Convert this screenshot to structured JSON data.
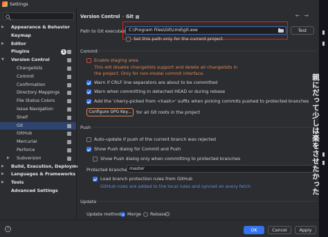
{
  "window": {
    "title": "Settings"
  },
  "sidebar": {
    "items": [
      {
        "label": "Appearance & Behavior",
        "bold": true,
        "chevron": "right",
        "indent": 0
      },
      {
        "label": "Keymap",
        "bold": true,
        "indent": 0
      },
      {
        "label": "Editor",
        "bold": true,
        "chevron": "right",
        "indent": 0
      },
      {
        "label": "Plugins",
        "bold": true,
        "indent": 0,
        "badge": "1"
      },
      {
        "label": "Version Control",
        "bold": true,
        "chevron": "down",
        "indent": 0
      },
      {
        "label": "Changelists",
        "indent": 1
      },
      {
        "label": "Commit",
        "indent": 1
      },
      {
        "label": "Confirmation",
        "indent": 1
      },
      {
        "label": "Directory Mappings",
        "indent": 1
      },
      {
        "label": "File Status Colors",
        "indent": 1
      },
      {
        "label": "Issue Navigation",
        "indent": 1
      },
      {
        "label": "Shelf",
        "indent": 1
      },
      {
        "label": "Git",
        "indent": 1,
        "selected": true
      },
      {
        "label": "GitHub",
        "indent": 1
      },
      {
        "label": "Mercurial",
        "indent": 1
      },
      {
        "label": "Perforce",
        "indent": 1
      },
      {
        "label": "Subversion",
        "indent": 1,
        "chevron": "right"
      },
      {
        "label": "Build, Execution, Deployment",
        "bold": true,
        "chevron": "right",
        "indent": 0
      },
      {
        "label": "Languages & Frameworks",
        "bold": true,
        "chevron": "right",
        "indent": 0
      },
      {
        "label": "Tools",
        "bold": true,
        "chevron": "right",
        "indent": 0
      },
      {
        "label": "Advanced Settings",
        "bold": true,
        "indent": 0
      }
    ]
  },
  "breadcrumb": {
    "parent": "Version Control",
    "separator": "›",
    "current": "Git"
  },
  "git": {
    "path_label": "Path to Git executable:",
    "path_value": "C:\\Program Files\\Git\\cmd\\git.exe",
    "test_button": "Test",
    "path_for_project": "Set this path only for the current project"
  },
  "commit": {
    "heading": "Commit",
    "staging_label": "Enable staging area",
    "staging_note_1": "This will disable changelists support and delete all changelists in",
    "staging_note_2": "the project. Only for non-modal commit interface.",
    "warn_crlf": "Warn if CRLF line separators are about to be committed",
    "warn_detached": "Warn when committing in detached HEAD or during rebase",
    "cherry_pick": "Add the 'cherry-picked from <hash>' suffix when picking commits pushed to protected branches",
    "gpg_button": "Configure GPG Key...",
    "gpg_note": "for all Git roots in the project"
  },
  "push": {
    "heading": "Push",
    "auto_update": "Auto-update if push of the current branch was rejected",
    "show_dialog": "Show Push dialog for Commit and Push",
    "show_dialog_protected": "Show Push dialog only when committing to protected branches",
    "protected_label": "Protected branches:",
    "protected_value": "master",
    "load_rules": "Load branch protection rules from GitHub",
    "load_rules_note": "GitHub rules are added to the local rules and synced on every fetch"
  },
  "update": {
    "heading": "Update",
    "method_label": "Update method:",
    "merge": "Merge",
    "rebase": "Rebase"
  },
  "footer": {
    "help": "?",
    "ok": "OK",
    "cancel": "Cancel",
    "apply": "Apply"
  },
  "overlay": {
    "japanese_text": "親にだって少しは楽をさせたかった"
  },
  "icons": {
    "nav_back": "←",
    "nav_forward": "→",
    "info": "i"
  }
}
